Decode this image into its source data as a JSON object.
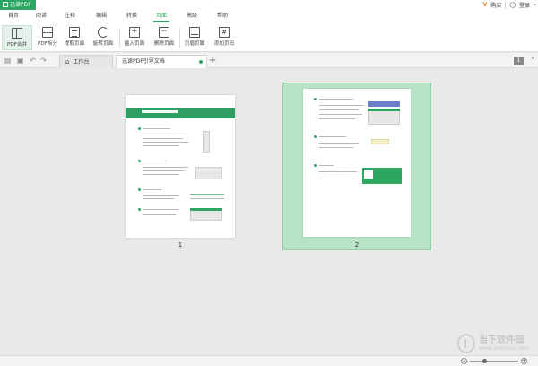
{
  "app": {
    "title": "迅读PDF",
    "accent": "#2ea662"
  },
  "titlebar": {
    "buy_label": "购买",
    "login_label": "登录"
  },
  "menu": {
    "items": [
      {
        "label": "首页"
      },
      {
        "label": "阅读"
      },
      {
        "label": "注释"
      },
      {
        "label": "编辑"
      },
      {
        "label": "转换"
      },
      {
        "label": "页面",
        "active": true
      },
      {
        "label": "高级"
      },
      {
        "label": "帮助"
      }
    ]
  },
  "ribbon": {
    "buttons": [
      {
        "label": "PDF合并",
        "icon": "merge-icon",
        "selected": true
      },
      {
        "label": "PDF拆分",
        "icon": "split-icon"
      },
      {
        "label": "提取页面",
        "icon": "extract-icon"
      },
      {
        "label": "旋转页面",
        "icon": "rotate-icon"
      },
      {
        "label": "插入页面",
        "icon": "insert-page-icon"
      },
      {
        "label": "删除页面",
        "icon": "delete-page-icon"
      },
      {
        "label": "页眉页脚",
        "icon": "header-footer-icon"
      },
      {
        "label": "添加页码",
        "icon": "page-number-icon"
      }
    ]
  },
  "tabs": {
    "home_label": "工作台",
    "file_label": "迅读PDF引导文档",
    "add_label": "+",
    "page_count": "1"
  },
  "pages": [
    {
      "number": "1",
      "heading": "迅读PDF阅读 PDF"
    },
    {
      "number": "2",
      "selected": true
    }
  ],
  "watermark": {
    "text": "当下软件园",
    "url": "www.downxia.com"
  }
}
